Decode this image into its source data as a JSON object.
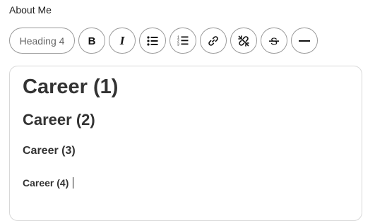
{
  "field": {
    "label": "About Me"
  },
  "toolbar": {
    "heading_select_value": "Heading 4",
    "buttons": [
      {
        "name": "bold",
        "icon": "bold-icon",
        "glyph": "B"
      },
      {
        "name": "italic",
        "icon": "italic-icon",
        "glyph": "I"
      },
      {
        "name": "bullet-list",
        "icon": "bullet-list-icon"
      },
      {
        "name": "ordered-list",
        "icon": "ordered-list-icon"
      },
      {
        "name": "link",
        "icon": "link-icon"
      },
      {
        "name": "unlink",
        "icon": "unlink-icon"
      },
      {
        "name": "strikethrough",
        "icon": "strikethrough-icon",
        "glyph": "S"
      },
      {
        "name": "horizontal-rule",
        "icon": "horizontal-rule-icon"
      }
    ]
  },
  "editor": {
    "headings": [
      {
        "level": 1,
        "text": "Career (1)"
      },
      {
        "level": 2,
        "text": "Career (2)"
      },
      {
        "level": 3,
        "text": "Career (3)"
      },
      {
        "level": 4,
        "text": "Career (4)"
      }
    ]
  }
}
